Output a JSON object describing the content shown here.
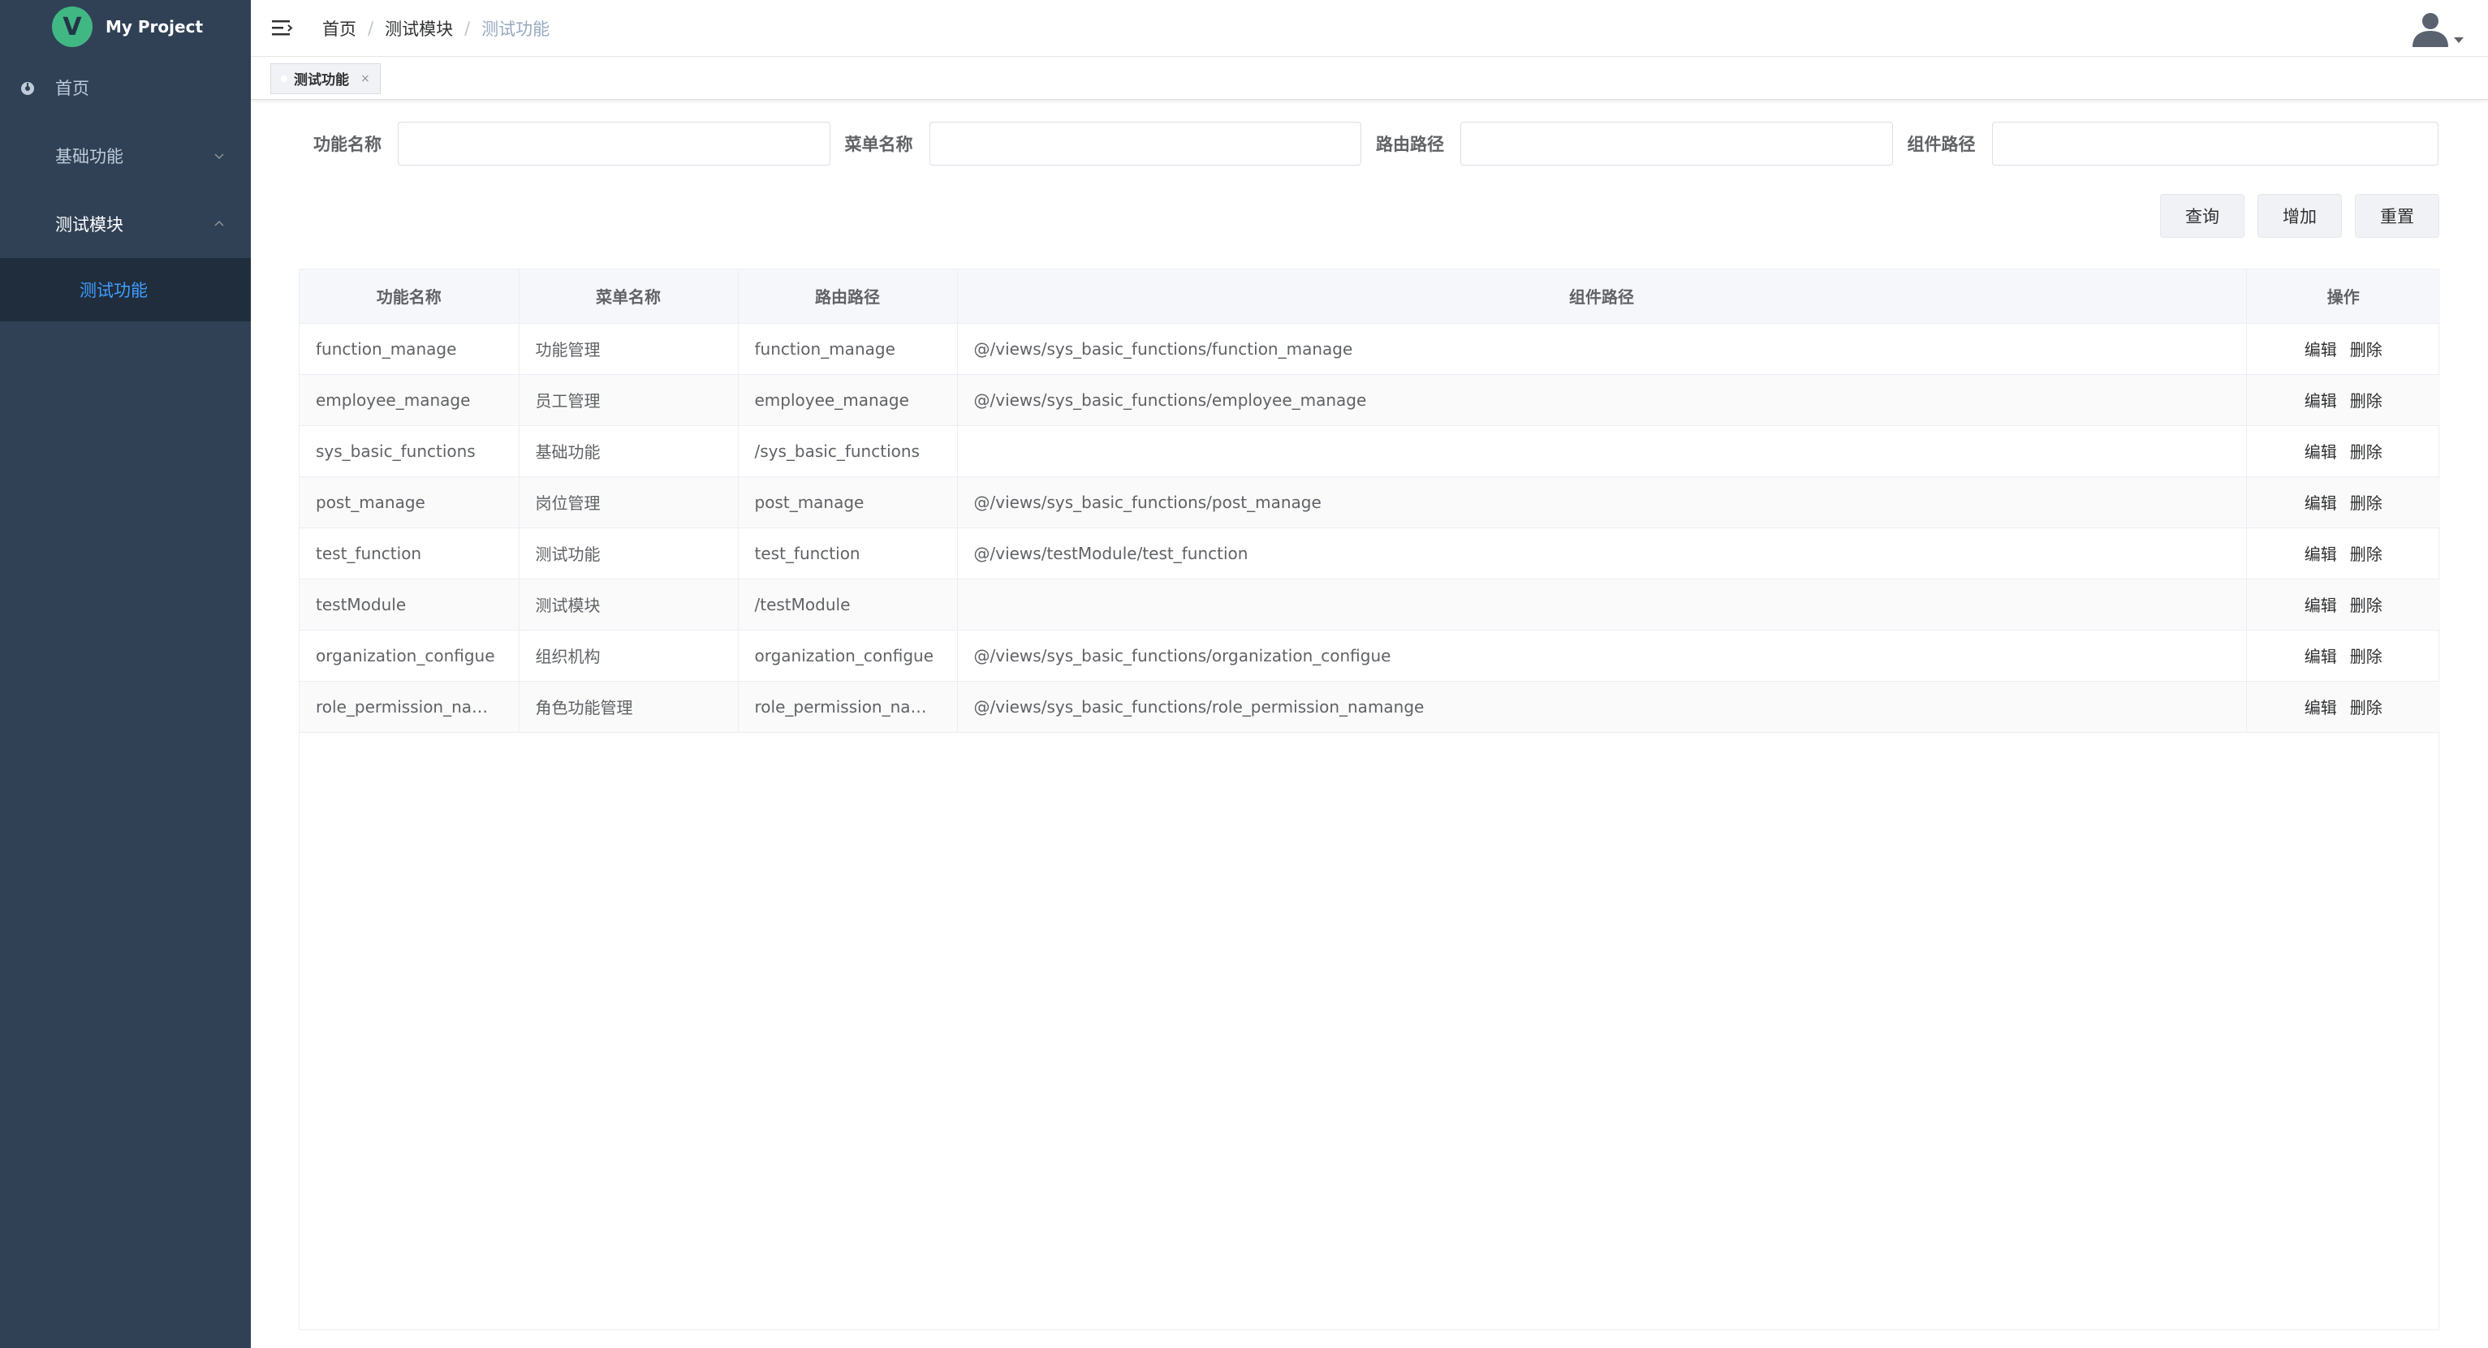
{
  "app": {
    "title": "My Project",
    "logo_letter": "V"
  },
  "sidebar": {
    "items": [
      {
        "label": "首页"
      },
      {
        "label": "基础功能"
      },
      {
        "label": "测试模块"
      }
    ],
    "subitems": [
      {
        "label": "测试功能"
      }
    ]
  },
  "breadcrumb": [
    "首页",
    "测试模块",
    "测试功能"
  ],
  "tags": [
    {
      "label": "测试功能",
      "close": "×"
    }
  ],
  "form": {
    "fields": [
      {
        "label": "功能名称",
        "value": ""
      },
      {
        "label": "菜单名称",
        "value": ""
      },
      {
        "label": "路由路径",
        "value": ""
      },
      {
        "label": "组件路径",
        "value": ""
      }
    ],
    "buttons": [
      "查询",
      "增加",
      "重置"
    ]
  },
  "table": {
    "headers": [
      "功能名称",
      "菜单名称",
      "路由路径",
      "组件路径",
      "操作"
    ],
    "rows": [
      [
        "function_manage",
        "功能管理",
        "function_manage",
        "@/views/sys_basic_functions/function_manage"
      ],
      [
        "employee_manage",
        "员工管理",
        "employee_manage",
        "@/views/sys_basic_functions/employee_manage"
      ],
      [
        "sys_basic_functions",
        "基础功能",
        "/sys_basic_functions",
        ""
      ],
      [
        "post_manage",
        "岗位管理",
        "post_manage",
        "@/views/sys_basic_functions/post_manage"
      ],
      [
        "test_function",
        "测试功能",
        "test_function",
        "@/views/testModule/test_function"
      ],
      [
        "testModule",
        "测试模块",
        "/testModule",
        ""
      ],
      [
        "organization_configue",
        "组织机构",
        "organization_configue",
        "@/views/sys_basic_functions/organization_configue"
      ],
      [
        "role_permission_nam…",
        "角色功能管理",
        "role_permission_nam…",
        "@/views/sys_basic_functions/role_permission_namange"
      ]
    ],
    "actions": {
      "edit": "编辑",
      "delete": "删除"
    }
  }
}
